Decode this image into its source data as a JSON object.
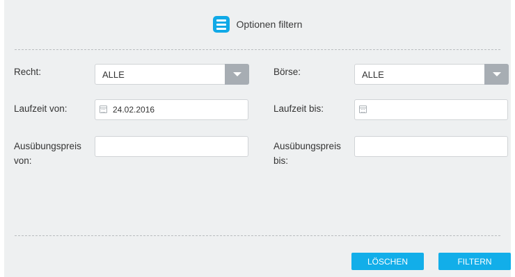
{
  "header": {
    "title": "Optionen filtern",
    "icon": "menu-icon"
  },
  "filters": {
    "recht": {
      "label": "Recht:",
      "value": "ALLE"
    },
    "boerse": {
      "label": "Börse:",
      "value": "ALLE"
    },
    "laufzeit_von": {
      "label": "Laufzeit von:",
      "value": "24.02.2016"
    },
    "laufzeit_bis": {
      "label": "Laufzeit bis:",
      "value": ""
    },
    "preis_von": {
      "label_line1": "Ausübungspreis",
      "label_line2": "von:",
      "value": ""
    },
    "preis_bis": {
      "label_line1": "Ausübungspreis",
      "label_line2": "bis:",
      "value": ""
    }
  },
  "buttons": {
    "clear": "LÖSCHEN",
    "filter": "FILTERN"
  },
  "colors": {
    "accent": "#12aee9",
    "panel": "#eef0f1",
    "arrow_bg": "#a7adb3"
  }
}
